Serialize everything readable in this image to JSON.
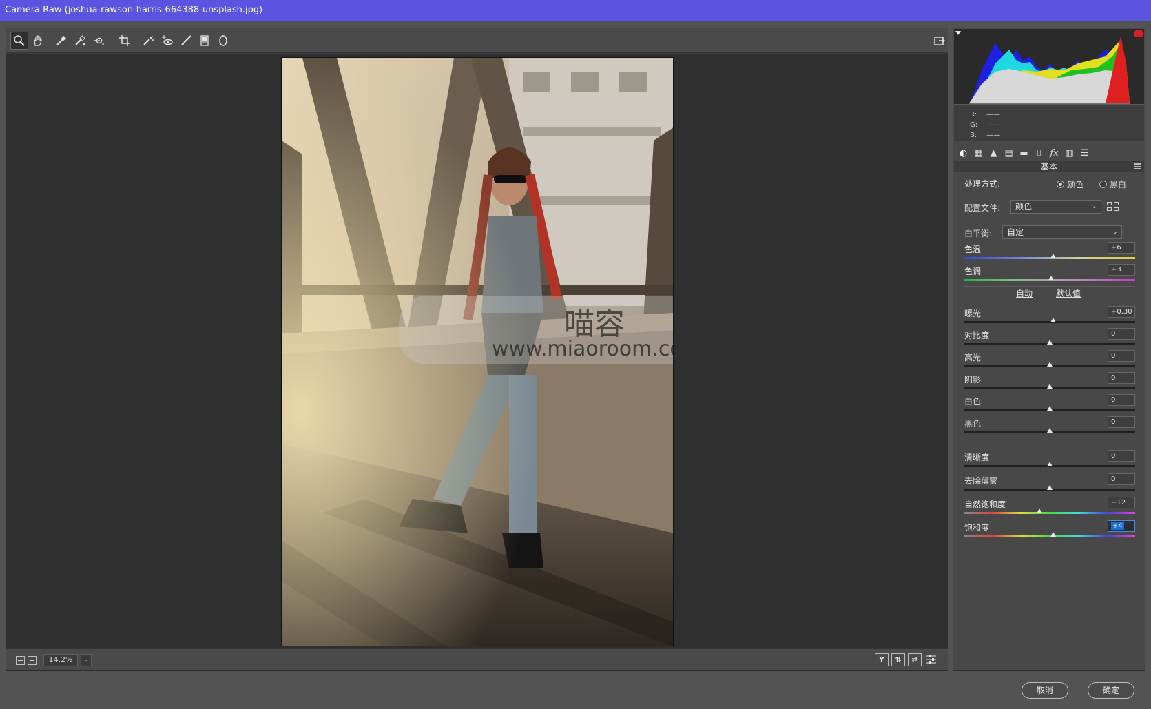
{
  "window": {
    "title": "Camera Raw (joshua-rawson-harris-664388-unsplash.jpg)"
  },
  "toolbar": {
    "tools": [
      "zoom-tool",
      "hand-tool",
      "white-balance-tool",
      "color-sampler-tool",
      "targeted-adjustment-tool",
      "crop-tool",
      "spot-removal-tool",
      "red-eye-tool",
      "adjustment-brush-tool",
      "graduated-filter-tool",
      "radial-filter-tool"
    ],
    "open_in_label": "open-preferences"
  },
  "status": {
    "zoom": "14.2%",
    "zoom_dropdown": "⌄",
    "zoom_out": "−",
    "zoom_in": "+",
    "view_y": "Y",
    "view_before_after": "⇅",
    "view_swap": "⇄"
  },
  "histogram": {
    "r_label": "R:",
    "g_label": "G:",
    "b_label": "B:",
    "r_val": "——",
    "g_val": "——",
    "b_val": "——"
  },
  "panel": {
    "section_title": "基本",
    "process_label": "处理方式:",
    "process_color": "颜色",
    "process_bw": "黑白",
    "profile_label": "配置文件:",
    "profile_value": "颜色",
    "wb_label": "白平衡:",
    "wb_value": "自定",
    "auto_link": "自动",
    "default_link": "默认值"
  },
  "sliders": {
    "temp": {
      "label": "色温",
      "value": "+6",
      "level": 0.52
    },
    "tint": {
      "label": "色调",
      "value": "+3",
      "level": 0.51
    },
    "exposure": {
      "label": "曝光",
      "value": "+0.30",
      "level": 0.52
    },
    "contrast": {
      "label": "对比度",
      "value": "0",
      "level": 0.5
    },
    "highlights": {
      "label": "高光",
      "value": "0",
      "level": 0.5
    },
    "shadows": {
      "label": "阴影",
      "value": "0",
      "level": 0.5
    },
    "whites": {
      "label": "白色",
      "value": "0",
      "level": 0.5
    },
    "blacks": {
      "label": "黑色",
      "value": "0",
      "level": 0.5
    },
    "clarity": {
      "label": "清晰度",
      "value": "0",
      "level": 0.5
    },
    "dehaze": {
      "label": "去除薄雾",
      "value": "0",
      "level": 0.5
    },
    "vibrance": {
      "label": "自然饱和度",
      "value": "−12",
      "level": 0.44
    },
    "saturation": {
      "label": "饱和度",
      "value": "+4",
      "level": 0.52
    }
  },
  "footer": {
    "cancel": "取消",
    "ok": "确定"
  },
  "watermark": {
    "brand": "喵容",
    "url": "www.miaoroom.com"
  },
  "colors": {
    "titlebar": "#5b54e0",
    "panel": "#484848",
    "canvas": "#2f2f2f"
  }
}
